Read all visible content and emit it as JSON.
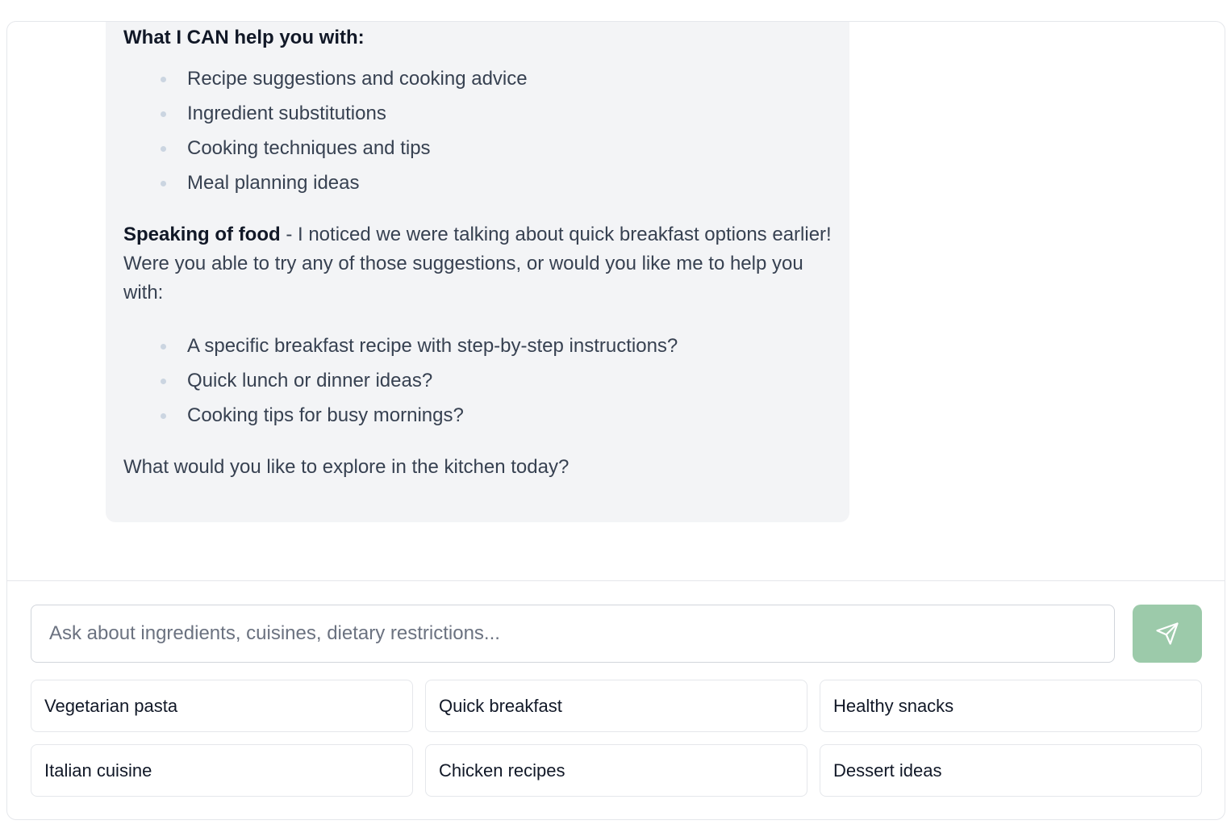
{
  "message": {
    "heading": "What I CAN help you with:",
    "can_help_items": [
      "Recipe suggestions and cooking advice",
      "Ingredient substitutions",
      "Cooking techniques and tips",
      "Meal planning ideas"
    ],
    "paragraph_bold": "Speaking of food",
    "paragraph_text": " - I noticed we were talking about quick breakfast options earlier! Were you able to try any of those suggestions, or would you like me to help you with:",
    "followup_items": [
      "A specific breakfast recipe with step-by-step instructions?",
      "Quick lunch or dinner ideas?",
      "Cooking tips for busy mornings?"
    ],
    "closing": "What would you like to explore in the kitchen today?"
  },
  "composer": {
    "placeholder": "Ask about ingredients, cuisines, dietary restrictions...",
    "value": "",
    "send_icon": "send-icon"
  },
  "suggestions": [
    "Vegetarian pasta",
    "Quick breakfast",
    "Healthy snacks",
    "Italian cuisine",
    "Chicken recipes",
    "Dessert ideas"
  ],
  "colors": {
    "bubble_bg": "#f3f4f6",
    "send_button": "#9ccaaa",
    "text": "#374151",
    "heading": "#111827"
  }
}
